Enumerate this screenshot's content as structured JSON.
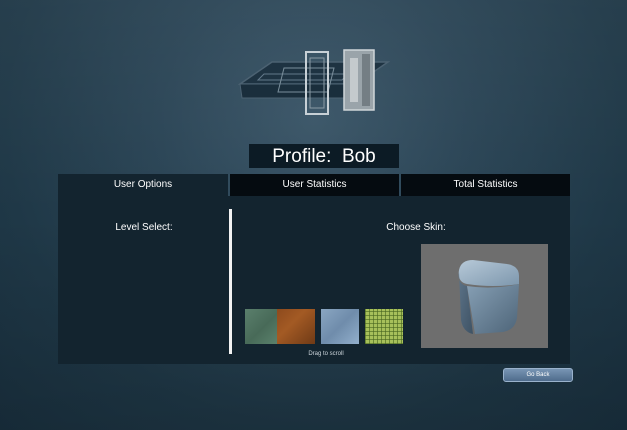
{
  "profile": {
    "title": "Profile:  Bob"
  },
  "tabs": [
    {
      "label": "User Options",
      "active": true
    },
    {
      "label": "User Statistics",
      "active": false
    },
    {
      "label": "Total Statistics",
      "active": false
    }
  ],
  "user_options": {
    "level_select_label": "Level Select:",
    "choose_skin_label": "Choose Skin:",
    "drag_hint": "Drag to scroll",
    "skins": [
      {
        "name": "green-metal",
        "color": "#5a7f6c"
      },
      {
        "name": "rusty-metal",
        "color": "#8d4a1d"
      },
      {
        "name": "blue-metal",
        "color": "#8aa6c2"
      },
      {
        "name": "green-grid",
        "color": "#a7c05a"
      }
    ]
  },
  "footer": {
    "back_label": "Go  Back"
  },
  "colors": {
    "panel": "#13242f",
    "tab_inactive": "#050b10",
    "button": "#5f7c9c"
  }
}
